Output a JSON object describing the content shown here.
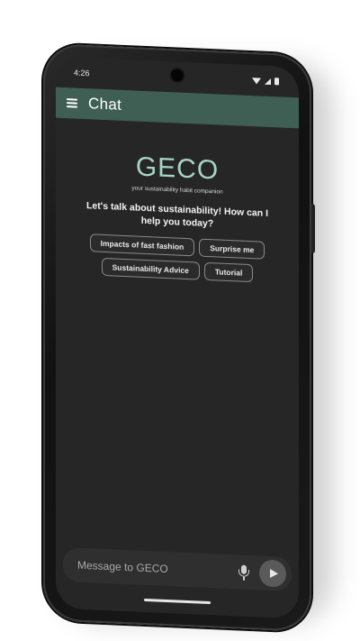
{
  "status_bar": {
    "time": "4:26"
  },
  "app_bar": {
    "title": "Chat",
    "menu_icon": "hamburger-menu-icon"
  },
  "brand": {
    "logo_text": "GECO",
    "tagline": "your sustainability habit companion"
  },
  "welcome": {
    "prompt": "Let's talk about sustainability! How can I help you today?"
  },
  "suggestions": [
    {
      "label": "Impacts of fast fashion"
    },
    {
      "label": "Surprise me"
    },
    {
      "label": "Sustainability Advice"
    },
    {
      "label": "Tutorial"
    }
  ],
  "composer": {
    "placeholder": "Message to GECO",
    "value": ""
  },
  "colors": {
    "app_bar": "#3f5f54",
    "logo": "#a6d5c4",
    "screen_bg": "#262626"
  }
}
